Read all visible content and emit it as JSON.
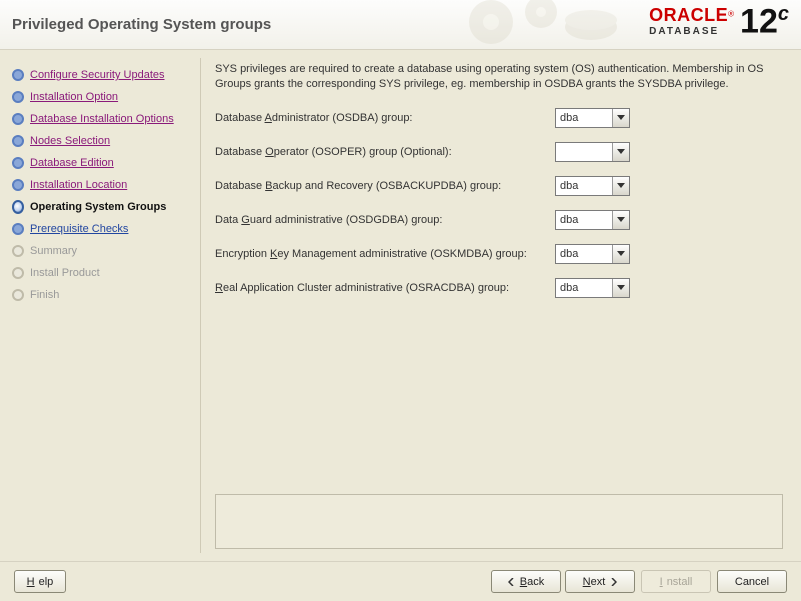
{
  "header": {
    "title": "Privileged Operating System groups",
    "brand_primary": "ORACLE",
    "brand_secondary": "DATABASE",
    "brand_version": "12",
    "brand_version_suffix": "c"
  },
  "sidebar": {
    "items": [
      {
        "label": "Configure Security Updates",
        "state": "done"
      },
      {
        "label": "Installation Option",
        "state": "done"
      },
      {
        "label": "Database Installation Options",
        "state": "done"
      },
      {
        "label": "Nodes Selection",
        "state": "done"
      },
      {
        "label": "Database Edition",
        "state": "done"
      },
      {
        "label": "Installation Location",
        "state": "done"
      },
      {
        "label": "Operating System Groups",
        "state": "current"
      },
      {
        "label": "Prerequisite Checks",
        "state": "next"
      },
      {
        "label": "Summary",
        "state": "pending"
      },
      {
        "label": "Install Product",
        "state": "pending"
      },
      {
        "label": "Finish",
        "state": "pending"
      }
    ]
  },
  "main": {
    "intro": "SYS privileges are required to create a database using operating system (OS) authentication. Membership in OS Groups grants the corresponding SYS privilege, eg. membership in OSDBA grants the SYSDBA privilege.",
    "rows": [
      {
        "pre": "Database ",
        "mn": "A",
        "post": "dministrator (OSDBA) group:",
        "value": "dba"
      },
      {
        "pre": "Database ",
        "mn": "O",
        "post": "perator (OSOPER) group (Optional):",
        "value": ""
      },
      {
        "pre": "Database ",
        "mn": "B",
        "post": "ackup and Recovery (OSBACKUPDBA) group:",
        "value": "dba"
      },
      {
        "pre": "Data ",
        "mn": "G",
        "post": "uard administrative (OSDGDBA) group:",
        "value": "dba"
      },
      {
        "pre": "Encryption ",
        "mn": "K",
        "post": "ey Management administrative (OSKMDBA) group:",
        "value": "dba"
      },
      {
        "pre": "",
        "mn": "R",
        "post": "eal Application Cluster administrative (OSRACDBA) group:",
        "value": "dba"
      }
    ]
  },
  "footer": {
    "help": "Help",
    "back": "Back",
    "next": "Next",
    "install": "Install",
    "cancel": "Cancel"
  }
}
